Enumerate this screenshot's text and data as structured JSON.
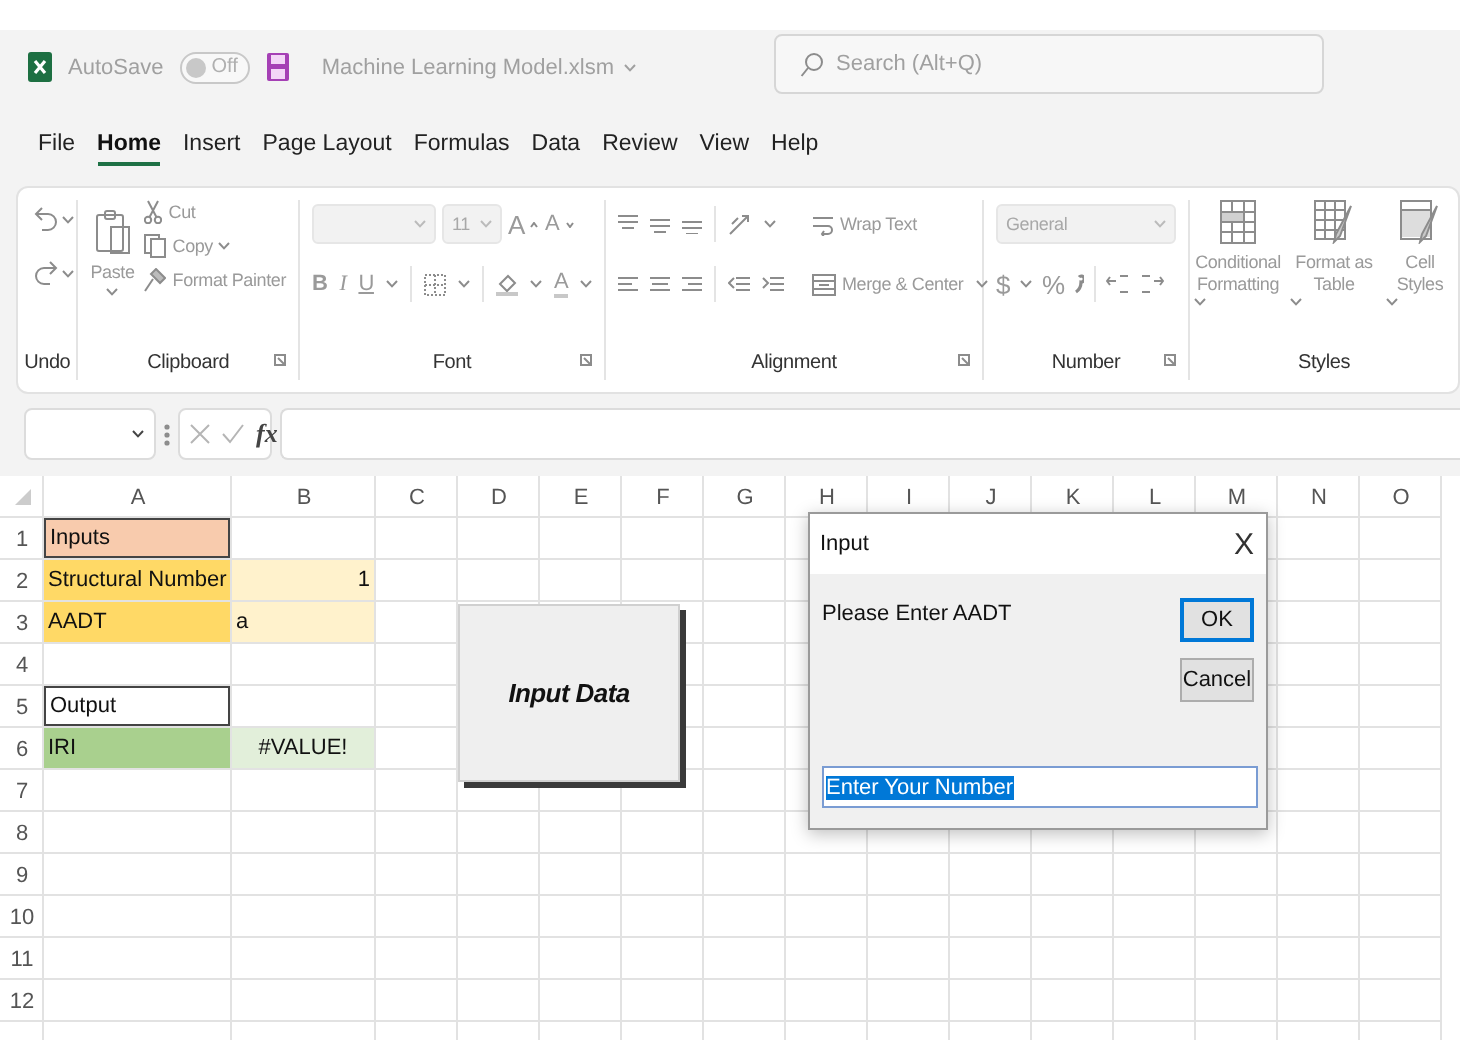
{
  "title_bar": {
    "autosave_label": "AutoSave",
    "autosave_state": "Off",
    "autosave_on": false,
    "file_name": "Machine Learning Model.xlsm",
    "search_placeholder": "Search (Alt+Q)"
  },
  "menu_tabs": [
    {
      "label": "File",
      "selected": false
    },
    {
      "label": "Home",
      "selected": true
    },
    {
      "label": "Insert",
      "selected": false
    },
    {
      "label": "Page Layout",
      "selected": false
    },
    {
      "label": "Formulas",
      "selected": false
    },
    {
      "label": "Data",
      "selected": false
    },
    {
      "label": "Review",
      "selected": false
    },
    {
      "label": "View",
      "selected": false
    },
    {
      "label": "Help",
      "selected": false
    }
  ],
  "ribbon": {
    "undo": {
      "label": "Undo"
    },
    "clipboard": {
      "label": "Clipboard",
      "paste": "Paste",
      "cut": "Cut",
      "copy": "Copy",
      "format_painter": "Format Painter"
    },
    "font": {
      "label": "Font",
      "size": "11",
      "grow": "A",
      "shrink": "A",
      "bold": "B",
      "italic": "I",
      "underline": "U",
      "font_color": "A"
    },
    "alignment": {
      "label": "Alignment",
      "wrap_text": "Wrap Text",
      "merge_center": "Merge & Center"
    },
    "number": {
      "label": "Number",
      "format": "General",
      "currency": "$",
      "percent": "%"
    },
    "styles": {
      "label": "Styles",
      "conditional": "Conditional Formatting",
      "format_table": "Format as Table",
      "cell_styles": "Cell Styles"
    }
  },
  "formula_bar": {
    "function_label": "fx"
  },
  "sheet": {
    "columns": [
      "A",
      "B",
      "C",
      "D",
      "E",
      "F",
      "G",
      "H",
      "I",
      "J",
      "K",
      "L",
      "M",
      "N",
      "O"
    ],
    "rows": [
      {
        "header": "1",
        "column_a": {
          "text": "Inputs",
          "color": "#f8cbad",
          "bordered": true,
          "kind": "text"
        }
      },
      {
        "header": "2",
        "column_a": {
          "text": "Structural Number",
          "color": "#ffd966",
          "bordered": false,
          "kind": "text"
        },
        "column_b": {
          "text": "1",
          "color": "#fff2cc",
          "bordered": false,
          "kind": "number"
        }
      },
      {
        "header": "3",
        "column_a": {
          "text": "AADT",
          "color": "#ffd966",
          "bordered": false,
          "kind": "text"
        },
        "column_b": {
          "text": "a",
          "color": "#fff2cc",
          "bordered": false,
          "kind": "text"
        }
      },
      {
        "header": "4"
      },
      {
        "header": "5",
        "column_a": {
          "text": "Output",
          "color": "#ffffff",
          "bordered": true,
          "kind": "text"
        }
      },
      {
        "header": "6",
        "column_a": {
          "text": "IRI",
          "color": "#a9d08e",
          "bordered": false,
          "kind": "text"
        },
        "column_b": {
          "text": "#VALUE!",
          "color": "#e2efda",
          "bordered": false,
          "kind": "error"
        }
      },
      {
        "header": "7"
      },
      {
        "header": "8"
      },
      {
        "header": "9"
      },
      {
        "header": "10"
      },
      {
        "header": "11"
      },
      {
        "header": "12"
      }
    ],
    "shape_button": {
      "label": "Input Data"
    }
  },
  "dialog": {
    "title": "Input",
    "close": "X",
    "prompt": "Please Enter AADT",
    "buttons": [
      {
        "label": "OK",
        "focused": true
      },
      {
        "label": "Cancel",
        "focused": false
      }
    ],
    "value": "Enter Your Number",
    "value_selected": true
  }
}
